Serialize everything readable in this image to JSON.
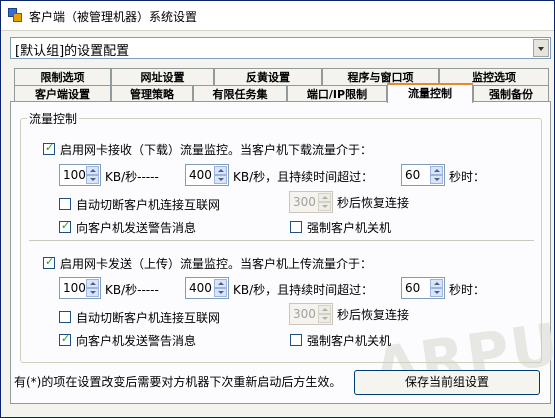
{
  "window": {
    "title": "客户端（被管理机器）系统设置"
  },
  "config_select": {
    "value": "[默认组]的设置配置"
  },
  "tabs_row1": [
    {
      "label": "限制选项"
    },
    {
      "label": "网址设置"
    },
    {
      "label": "反黄设置"
    },
    {
      "label": "程序与窗口项"
    },
    {
      "label": "监控选项"
    }
  ],
  "tabs_row2": [
    {
      "label": "客户端设置"
    },
    {
      "label": "管理策略"
    },
    {
      "label": "有限任务集"
    },
    {
      "label": "端口/IP限制"
    },
    {
      "label": "流量控制",
      "active": true
    },
    {
      "label": "强制备份"
    }
  ],
  "group_title": "流量控制",
  "download": {
    "enable_label": "启用网卡接收（下载）流量监控。当客户机下载流量介于：",
    "enable_checked": true,
    "min_value": "100",
    "unit_range": "KB/秒-----",
    "max_value": "400",
    "unit_duration": "KB/秒，且持续时间超过：",
    "duration_value": "60",
    "seconds_when": "秒时：",
    "disconnect_label": "自动切断客户机连接互联网",
    "disconnect_checked": false,
    "restore_value": "300",
    "restore_label": "秒后恢复连接",
    "warn_label": "向客户机发送警告消息",
    "warn_checked": true,
    "shutdown_label": "强制客户机关机",
    "shutdown_checked": false
  },
  "upload": {
    "enable_label": "启用网卡发送（上传）流量监控。当客户机上传流量介于：",
    "enable_checked": true,
    "min_value": "100",
    "unit_range": "KB/秒-----",
    "max_value": "400",
    "unit_duration": "KB/秒，且持续时间超过：",
    "duration_value": "60",
    "seconds_when": "秒时：",
    "disconnect_label": "自动切断客户机连接互联网",
    "disconnect_checked": false,
    "restore_value": "300",
    "restore_label": "秒后恢复连接",
    "warn_label": "向客户机发送警告消息",
    "warn_checked": true,
    "shutdown_label": "强制客户机关机",
    "shutdown_checked": false
  },
  "footer": {
    "note": "有(*)的项在设置改变后需要对方机器下次重新启动后方生效。",
    "save_button": "保存当前组设置"
  },
  "watermark": "ARPUN"
}
